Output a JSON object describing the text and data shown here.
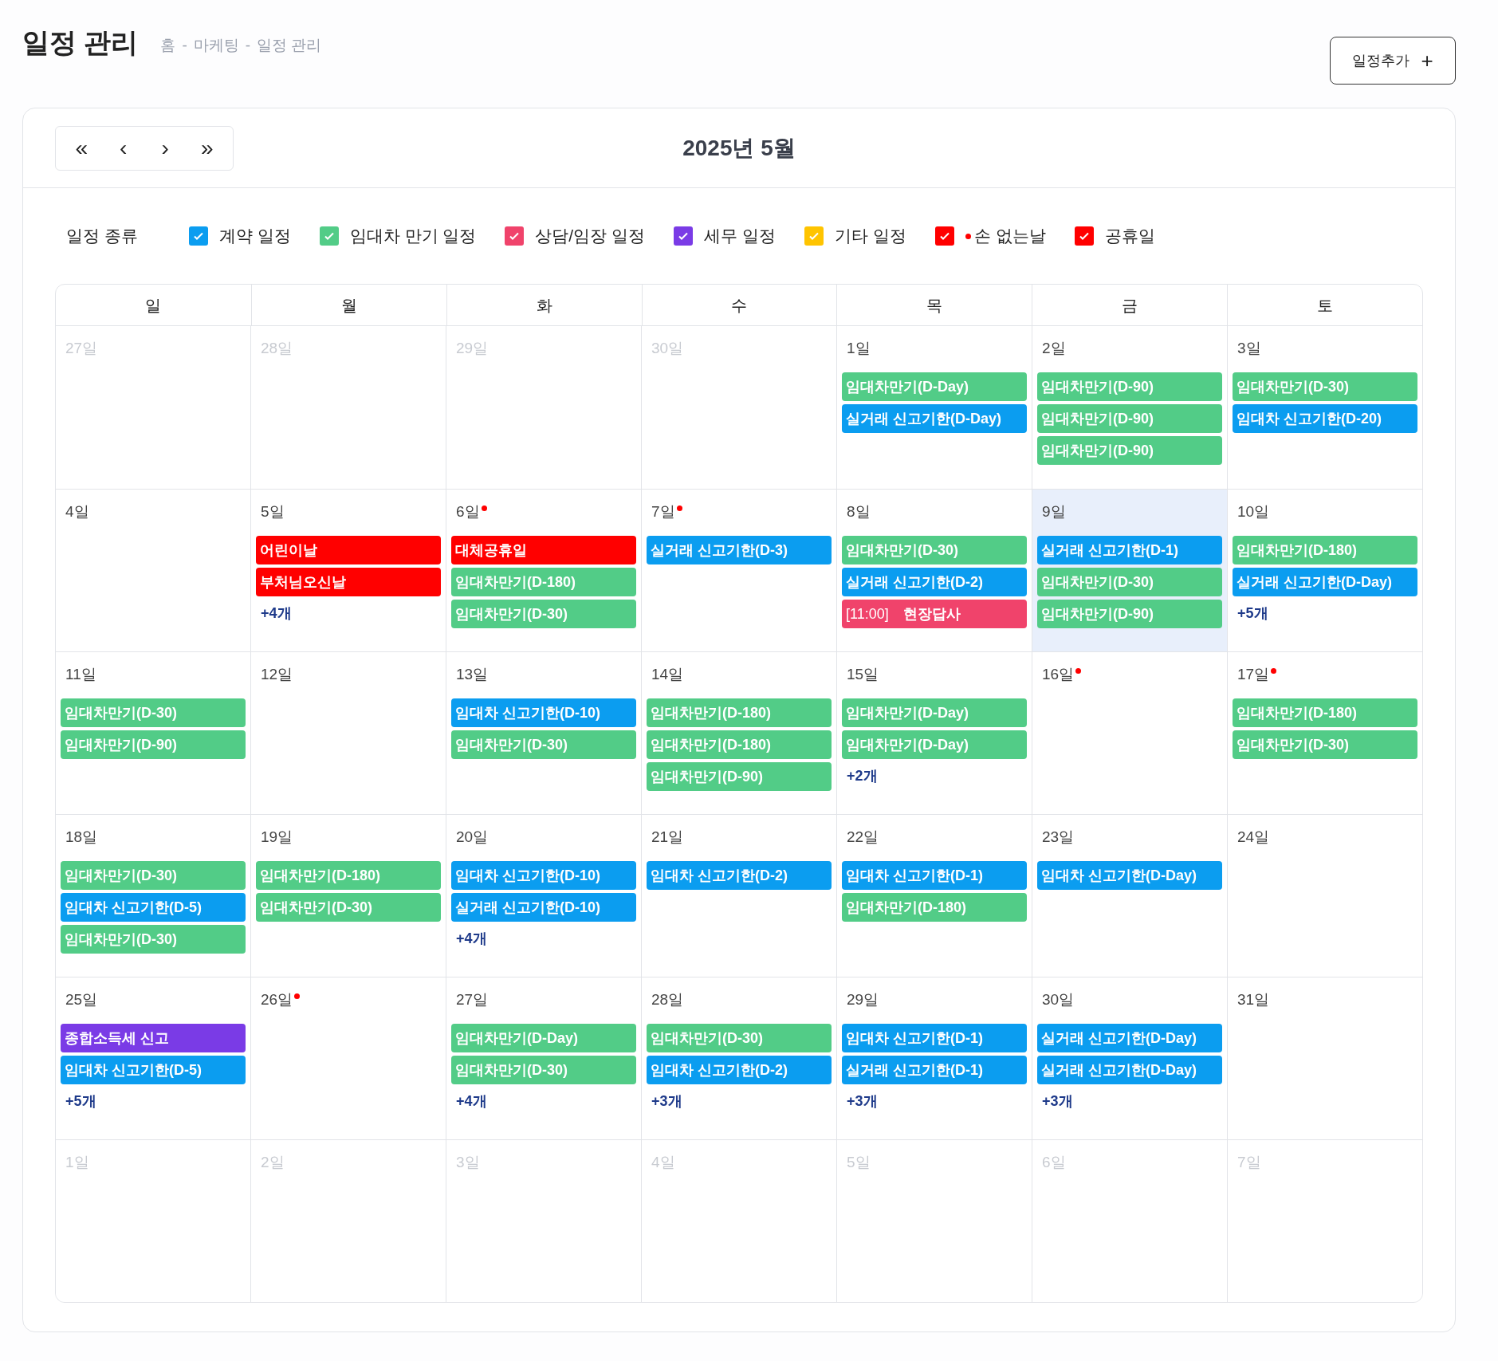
{
  "page": {
    "title": "일정 관리",
    "breadcrumb": [
      "홈",
      "마케팅",
      "일정 관리"
    ],
    "separator": "-",
    "add_button": "일정추가",
    "add_icon": "+"
  },
  "nav": [
    "«",
    "‹",
    "›",
    "»"
  ],
  "month_title": "2025년 5월",
  "legend": {
    "label": "일정 종류",
    "items": [
      {
        "label": "계약 일정",
        "color": "#0b9df0",
        "checked": true,
        "dot": false
      },
      {
        "label": "임대차 만기 일정",
        "color": "#52cc87",
        "checked": true,
        "dot": false
      },
      {
        "label": "상담/임장 일정",
        "color": "#f0436b",
        "checked": true,
        "dot": false
      },
      {
        "label": "세무 일정",
        "color": "#7a3be6",
        "checked": true,
        "dot": false
      },
      {
        "label": "기타 일정",
        "color": "#ffc400",
        "checked": true,
        "dot": false
      },
      {
        "label": "손 없는날",
        "color": "#ff0000",
        "checked": true,
        "dot": true
      },
      {
        "label": "공휴일",
        "color": "#ff0000",
        "checked": true,
        "dot": false
      }
    ]
  },
  "weekdays": [
    "일",
    "월",
    "화",
    "수",
    "목",
    "금",
    "토"
  ],
  "weeks": [
    [
      {
        "label": "27일",
        "muted": true,
        "dot": false,
        "selected": false
      },
      {
        "label": "28일",
        "muted": true,
        "dot": false,
        "selected": false
      },
      {
        "label": "29일",
        "muted": true,
        "dot": false,
        "selected": false
      },
      {
        "label": "30일",
        "muted": true,
        "dot": false,
        "selected": false
      },
      {
        "label": "1일",
        "muted": false,
        "dot": false,
        "selected": false,
        "events": [
          {
            "kind": "lease",
            "text": "임대차만기(D-Day)"
          },
          {
            "kind": "deadline",
            "text": "실거래 신고기한(D-Day)"
          }
        ]
      },
      {
        "label": "2일",
        "muted": false,
        "dot": false,
        "selected": false,
        "events": [
          {
            "kind": "lease",
            "text": "임대차만기(D-90)"
          },
          {
            "kind": "lease",
            "text": "임대차만기(D-90)"
          },
          {
            "kind": "lease",
            "text": "임대차만기(D-90)"
          }
        ]
      },
      {
        "label": "3일",
        "muted": false,
        "dot": false,
        "selected": false,
        "events": [
          {
            "kind": "lease",
            "text": "임대차만기(D-30)"
          },
          {
            "kind": "deadline",
            "text": "임대차 신고기한(D-20)"
          }
        ]
      }
    ],
    [
      {
        "label": "4일",
        "muted": false,
        "dot": false,
        "selected": false
      },
      {
        "label": "5일",
        "muted": false,
        "dot": false,
        "selected": false,
        "events": [
          {
            "kind": "holiday",
            "text": "어린이날"
          },
          {
            "kind": "holiday",
            "text": "부처님오신날"
          }
        ],
        "more": "+4개"
      },
      {
        "label": "6일",
        "muted": false,
        "dot": true,
        "selected": false,
        "events": [
          {
            "kind": "holiday",
            "text": "대체공휴일"
          },
          {
            "kind": "lease",
            "text": "임대차만기(D-180)"
          },
          {
            "kind": "lease",
            "text": "임대차만기(D-30)"
          }
        ]
      },
      {
        "label": "7일",
        "muted": false,
        "dot": true,
        "selected": false,
        "events": [
          {
            "kind": "deadline",
            "text": "실거래 신고기한(D-3)"
          }
        ]
      },
      {
        "label": "8일",
        "muted": false,
        "dot": false,
        "selected": false,
        "events": [
          {
            "kind": "lease",
            "text": "임대차만기(D-30)"
          },
          {
            "kind": "deadline",
            "text": "실거래 신고기한(D-2)"
          },
          {
            "kind": "consult",
            "time": "[11:00]",
            "text": "현장답사"
          }
        ]
      },
      {
        "label": "9일",
        "muted": false,
        "dot": false,
        "selected": true,
        "events": [
          {
            "kind": "deadline",
            "text": "실거래 신고기한(D-1)"
          },
          {
            "kind": "lease",
            "text": "임대차만기(D-30)"
          },
          {
            "kind": "lease",
            "text": "임대차만기(D-90)"
          }
        ]
      },
      {
        "label": "10일",
        "muted": false,
        "dot": false,
        "selected": false,
        "events": [
          {
            "kind": "lease",
            "text": "임대차만기(D-180)"
          },
          {
            "kind": "deadline",
            "text": "실거래 신고기한(D-Day)"
          }
        ],
        "more": "+5개"
      }
    ],
    [
      {
        "label": "11일",
        "muted": false,
        "dot": false,
        "selected": false,
        "events": [
          {
            "kind": "lease",
            "text": "임대차만기(D-30)"
          },
          {
            "kind": "lease",
            "text": "임대차만기(D-90)"
          }
        ]
      },
      {
        "label": "12일",
        "muted": false,
        "dot": false,
        "selected": false
      },
      {
        "label": "13일",
        "muted": false,
        "dot": false,
        "selected": false,
        "events": [
          {
            "kind": "deadline",
            "text": "임대차 신고기한(D-10)"
          },
          {
            "kind": "lease",
            "text": "임대차만기(D-30)"
          }
        ]
      },
      {
        "label": "14일",
        "muted": false,
        "dot": false,
        "selected": false,
        "events": [
          {
            "kind": "lease",
            "text": "임대차만기(D-180)"
          },
          {
            "kind": "lease",
            "text": "임대차만기(D-180)"
          },
          {
            "kind": "lease",
            "text": "임대차만기(D-90)"
          }
        ]
      },
      {
        "label": "15일",
        "muted": false,
        "dot": false,
        "selected": false,
        "events": [
          {
            "kind": "lease",
            "text": "임대차만기(D-Day)"
          },
          {
            "kind": "lease",
            "text": "임대차만기(D-Day)"
          }
        ],
        "more": "+2개"
      },
      {
        "label": "16일",
        "muted": false,
        "dot": true,
        "selected": false
      },
      {
        "label": "17일",
        "muted": false,
        "dot": true,
        "selected": false,
        "events": [
          {
            "kind": "lease",
            "text": "임대차만기(D-180)"
          },
          {
            "kind": "lease",
            "text": "임대차만기(D-30)"
          }
        ]
      }
    ],
    [
      {
        "label": "18일",
        "muted": false,
        "dot": false,
        "selected": false,
        "events": [
          {
            "kind": "lease",
            "text": "임대차만기(D-30)"
          },
          {
            "kind": "deadline",
            "text": "임대차 신고기한(D-5)"
          },
          {
            "kind": "lease",
            "text": "임대차만기(D-30)"
          }
        ]
      },
      {
        "label": "19일",
        "muted": false,
        "dot": false,
        "selected": false,
        "events": [
          {
            "kind": "lease",
            "text": "임대차만기(D-180)"
          },
          {
            "kind": "lease",
            "text": "임대차만기(D-30)"
          }
        ]
      },
      {
        "label": "20일",
        "muted": false,
        "dot": false,
        "selected": false,
        "events": [
          {
            "kind": "deadline",
            "text": "임대차 신고기한(D-10)"
          },
          {
            "kind": "deadline",
            "text": "실거래 신고기한(D-10)"
          }
        ],
        "more": "+4개"
      },
      {
        "label": "21일",
        "muted": false,
        "dot": false,
        "selected": false,
        "events": [
          {
            "kind": "deadline",
            "text": "임대차 신고기한(D-2)"
          }
        ]
      },
      {
        "label": "22일",
        "muted": false,
        "dot": false,
        "selected": false,
        "events": [
          {
            "kind": "deadline",
            "text": "임대차 신고기한(D-1)"
          },
          {
            "kind": "lease",
            "text": "임대차만기(D-180)"
          }
        ]
      },
      {
        "label": "23일",
        "muted": false,
        "dot": false,
        "selected": false,
        "events": [
          {
            "kind": "deadline",
            "text": "임대차 신고기한(D-Day)"
          }
        ]
      },
      {
        "label": "24일",
        "muted": false,
        "dot": false,
        "selected": false
      }
    ],
    [
      {
        "label": "25일",
        "muted": false,
        "dot": false,
        "selected": false,
        "events": [
          {
            "kind": "tax",
            "text": "종합소득세 신고"
          },
          {
            "kind": "deadline",
            "text": "임대차 신고기한(D-5)"
          }
        ],
        "more": "+5개"
      },
      {
        "label": "26일",
        "muted": false,
        "dot": true,
        "selected": false
      },
      {
        "label": "27일",
        "muted": false,
        "dot": false,
        "selected": false,
        "events": [
          {
            "kind": "lease",
            "text": "임대차만기(D-Day)"
          },
          {
            "kind": "lease",
            "text": "임대차만기(D-30)"
          }
        ],
        "more": "+4개"
      },
      {
        "label": "28일",
        "muted": false,
        "dot": false,
        "selected": false,
        "events": [
          {
            "kind": "lease",
            "text": "임대차만기(D-30)"
          },
          {
            "kind": "deadline",
            "text": "임대차 신고기한(D-2)"
          }
        ],
        "more": "+3개"
      },
      {
        "label": "29일",
        "muted": false,
        "dot": false,
        "selected": false,
        "events": [
          {
            "kind": "deadline",
            "text": "임대차 신고기한(D-1)"
          },
          {
            "kind": "deadline",
            "text": "실거래 신고기한(D-1)"
          }
        ],
        "more": "+3개"
      },
      {
        "label": "30일",
        "muted": false,
        "dot": false,
        "selected": false,
        "events": [
          {
            "kind": "deadline",
            "text": "실거래 신고기한(D-Day)"
          },
          {
            "kind": "deadline",
            "text": "실거래 신고기한(D-Day)"
          }
        ],
        "more": "+3개"
      },
      {
        "label": "31일",
        "muted": false,
        "dot": false,
        "selected": false
      }
    ],
    [
      {
        "label": "1일",
        "muted": true,
        "dot": false,
        "selected": false
      },
      {
        "label": "2일",
        "muted": true,
        "dot": false,
        "selected": false
      },
      {
        "label": "3일",
        "muted": true,
        "dot": false,
        "selected": false
      },
      {
        "label": "4일",
        "muted": true,
        "dot": false,
        "selected": false
      },
      {
        "label": "5일",
        "muted": true,
        "dot": false,
        "selected": false
      },
      {
        "label": "6일",
        "muted": true,
        "dot": false,
        "selected": false
      },
      {
        "label": "7일",
        "muted": true,
        "dot": false,
        "selected": false
      }
    ]
  ]
}
